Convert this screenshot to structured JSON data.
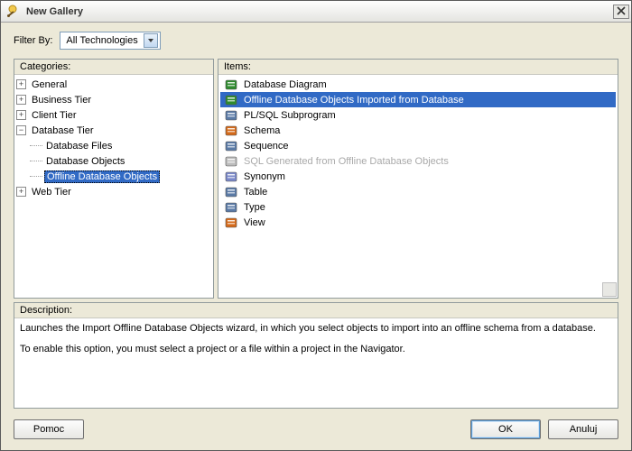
{
  "window": {
    "title": "New Gallery"
  },
  "filter": {
    "label": "Filter By:",
    "value": "All Technologies"
  },
  "panels": {
    "categories_label": "Categories:",
    "items_label": "Items:",
    "description_label": "Description:"
  },
  "categories": {
    "nodes": [
      {
        "label": "General",
        "exp": "+"
      },
      {
        "label": "Business Tier",
        "exp": "+"
      },
      {
        "label": "Client Tier",
        "exp": "+"
      },
      {
        "label": "Database Tier",
        "exp": "−",
        "kids": [
          {
            "label": "Database Files"
          },
          {
            "label": "Database Objects"
          },
          {
            "label": "Offline Database Objects",
            "selected": true
          }
        ]
      },
      {
        "label": "Web Tier",
        "exp": "+"
      }
    ]
  },
  "items": [
    {
      "label": "Database Diagram",
      "icon": "diagram-icon",
      "color": "#2e8b2e"
    },
    {
      "label": "Offline Database Objects Imported from Database",
      "icon": "db-import-icon",
      "color": "#2e8b2e",
      "selected": true
    },
    {
      "label": "PL/SQL Subprogram",
      "icon": "plsql-icon",
      "color": "#5a7aa6"
    },
    {
      "label": "Schema",
      "icon": "schema-icon",
      "color": "#d46a1a"
    },
    {
      "label": "Sequence",
      "icon": "sequence-icon",
      "color": "#5a7aa6"
    },
    {
      "label": "SQL Generated from Offline Database Objects",
      "icon": "sql-gen-icon",
      "color": "#bdbdbd",
      "disabled": true
    },
    {
      "label": "Synonym",
      "icon": "synonym-icon",
      "color": "#7a88c9"
    },
    {
      "label": "Table",
      "icon": "table-icon",
      "color": "#5a7aa6"
    },
    {
      "label": "Type",
      "icon": "type-icon",
      "color": "#5a7aa6"
    },
    {
      "label": "View",
      "icon": "view-icon",
      "color": "#d46a1a"
    }
  ],
  "description": {
    "line1": "Launches the Import Offline Database Objects wizard, in which you select objects to import into an offline schema from a database.",
    "line2": "To enable this option, you must select a project or a file within a project in the Navigator."
  },
  "buttons": {
    "help": "Pomoc",
    "ok": "OK",
    "cancel": "Anuluj"
  }
}
